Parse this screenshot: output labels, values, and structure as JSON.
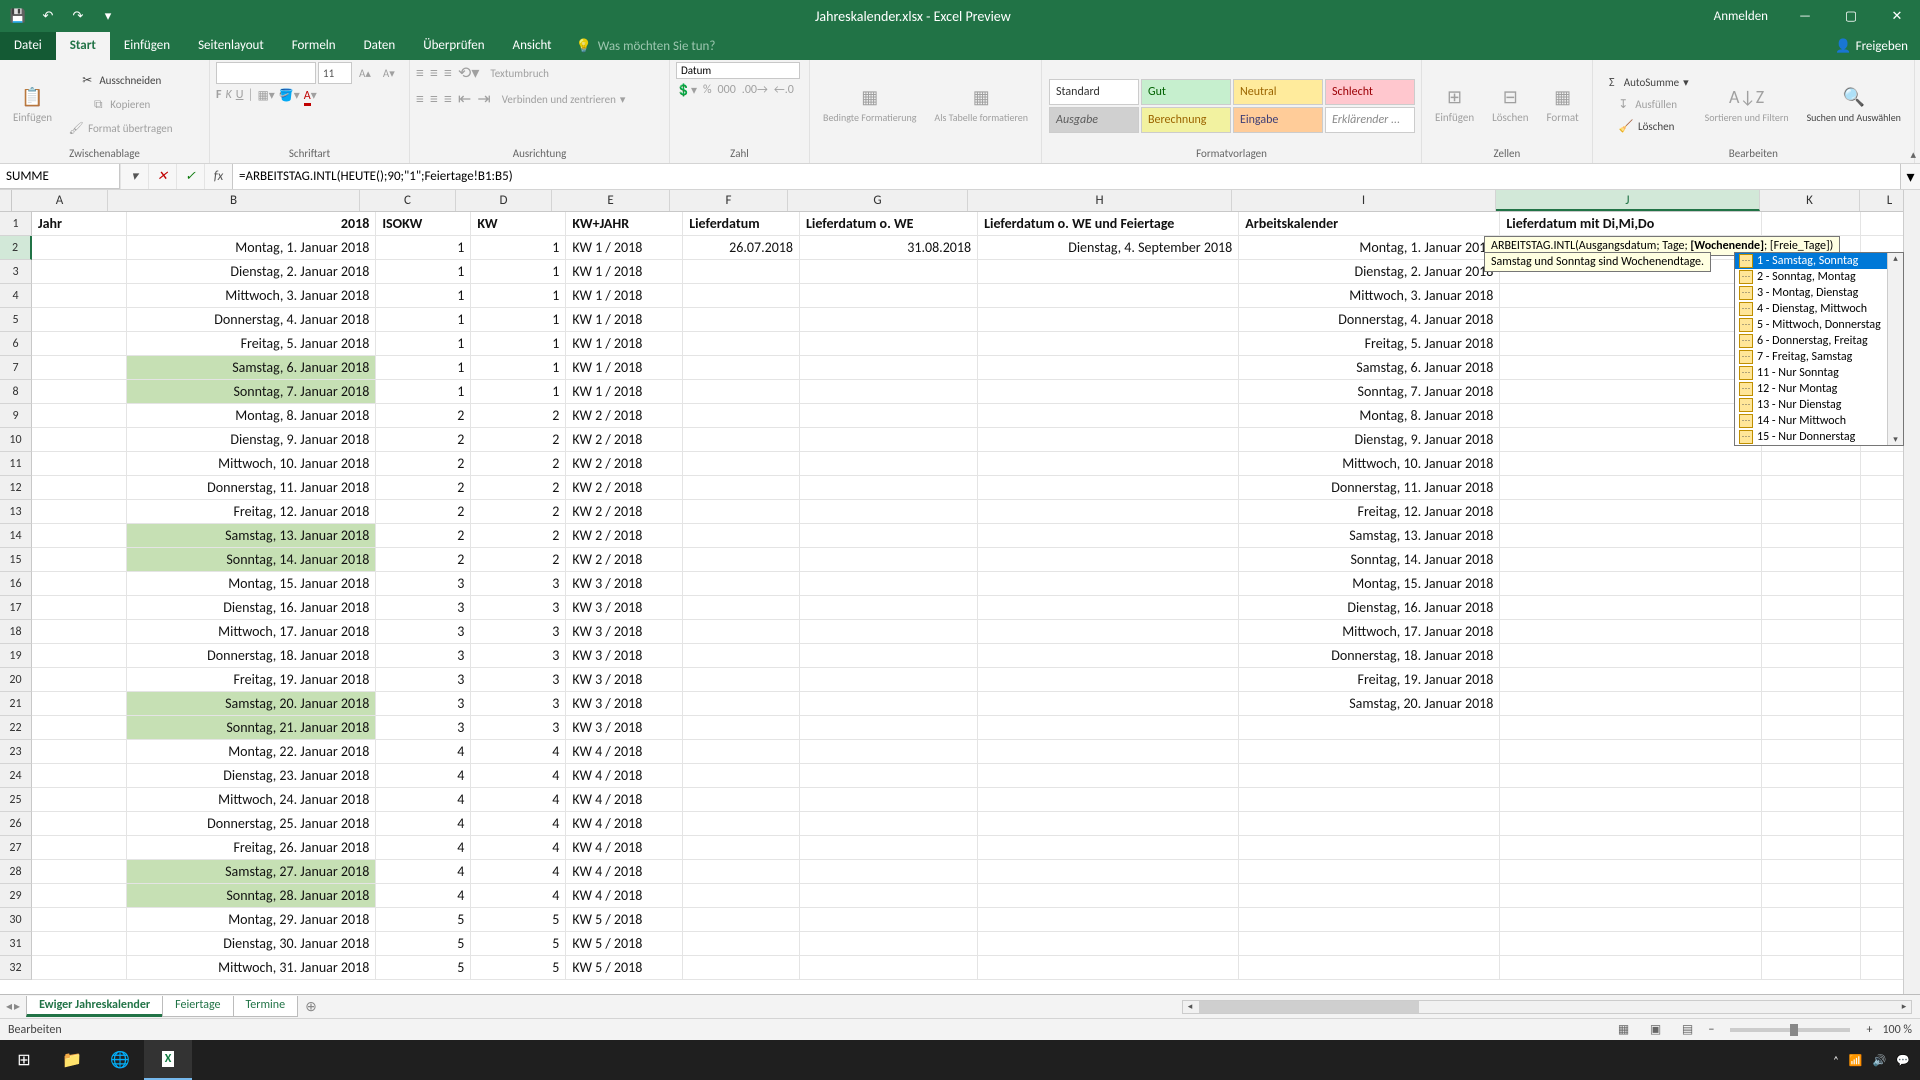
{
  "titlebar": {
    "title": "Jahreskalender.xlsx - Excel Preview",
    "anmelden": "Anmelden"
  },
  "tabs": {
    "file": "Datei",
    "items": [
      "Start",
      "Einfügen",
      "Seitenlayout",
      "Formeln",
      "Daten",
      "Überprüfen",
      "Ansicht"
    ],
    "active": "Start",
    "tellme": "Was möchten Sie tun?",
    "share": "Freigeben"
  },
  "ribbon": {
    "clipboard": {
      "paste": "Einfügen",
      "cut": "Ausschneiden",
      "copy": "Kopieren",
      "painter": "Format übertragen",
      "label": "Zwischenablage"
    },
    "font": {
      "name": "",
      "size": "11",
      "label": "Schriftart"
    },
    "align": {
      "merge": "Verbinden und zentrieren",
      "wrap": "Textumbruch",
      "label": "Ausrichtung"
    },
    "number": {
      "format": "Datum",
      "label": "Zahl"
    },
    "tables": {
      "cond": "Bedingte Formatierung",
      "astable": "Als Tabelle formatieren"
    },
    "styles": {
      "label": "Formatvorlagen",
      "standard": "Standard",
      "gut": "Gut",
      "neutral": "Neutral",
      "schlecht": "Schlecht",
      "ausgabe": "Ausgabe",
      "berechnung": "Berechnung",
      "eingabe": "Eingabe",
      "erklar": "Erklärender ..."
    },
    "cells": {
      "insert": "Einfügen",
      "delete": "Löschen",
      "format": "Format",
      "label": "Zellen"
    },
    "editing": {
      "sum": "AutoSumme",
      "fill": "Ausfüllen",
      "clear": "Löschen",
      "sort": "Sortieren und Filtern",
      "find": "Suchen und Auswählen",
      "label": "Bearbeiten"
    }
  },
  "formulabar": {
    "namebox": "SUMME",
    "formula": "=ARBEITSTAG.INTL(HEUTE();90;\"1\";Feiertage!B1:B5)"
  },
  "tooltip": {
    "sig": "ARBEITSTAG.INTL(Ausgangsdatum; Tage; ",
    "hl": "[Wochenende]",
    "rest": "; [Freie_Tage])",
    "desc": "Samstag und Sonntag sind Wochenendtage."
  },
  "dropdown": {
    "items": [
      {
        "code": "1",
        "label": "Samstag, Sonntag"
      },
      {
        "code": "2",
        "label": "Sonntag, Montag"
      },
      {
        "code": "3",
        "label": "Montag, Dienstag"
      },
      {
        "code": "4",
        "label": "Dienstag, Mittwoch"
      },
      {
        "code": "5",
        "label": "Mittwoch, Donnerstag"
      },
      {
        "code": "6",
        "label": "Donnerstag, Freitag"
      },
      {
        "code": "7",
        "label": "Freitag, Samstag"
      },
      {
        "code": "11",
        "label": "Nur Sonntag"
      },
      {
        "code": "12",
        "label": "Nur Montag"
      },
      {
        "code": "13",
        "label": "Nur Dienstag"
      },
      {
        "code": "14",
        "label": "Nur Mittwoch"
      },
      {
        "code": "15",
        "label": "Nur Donnerstag"
      }
    ],
    "selected": 0
  },
  "columns": [
    "A",
    "B",
    "C",
    "D",
    "E",
    "F",
    "G",
    "H",
    "I",
    "J",
    "K",
    "L"
  ],
  "headers": {
    "A": "Jahr",
    "B": "2018",
    "C": "ISOKW",
    "D": "KW",
    "E": "KW+JAHR",
    "F": "Lieferdatum",
    "G": "Lieferdatum o. WE",
    "H": "Lieferdatum o. WE und Feiertage",
    "I": "Arbeitskalender",
    "J": "Lieferdatum mit Di,Mi,Do"
  },
  "rows": [
    {
      "n": 2,
      "B": "Montag, 1. Januar 2018",
      "C": "1",
      "D": "1",
      "E": "KW 1 / 2018",
      "F": "26.07.2018",
      "G": "31.08.2018",
      "H": "Dienstag, 4. September 2018",
      "I": "Montag, 1. Januar 2018",
      "we": false,
      "J_edit": true
    },
    {
      "n": 3,
      "B": "Dienstag, 2. Januar 2018",
      "C": "1",
      "D": "1",
      "E": "KW 1 / 2018",
      "I": "Dienstag, 2. Januar 2018",
      "we": false
    },
    {
      "n": 4,
      "B": "Mittwoch, 3. Januar 2018",
      "C": "1",
      "D": "1",
      "E": "KW 1 / 2018",
      "I": "Mittwoch, 3. Januar 2018",
      "we": false
    },
    {
      "n": 5,
      "B": "Donnerstag, 4. Januar 2018",
      "C": "1",
      "D": "1",
      "E": "KW 1 / 2018",
      "I": "Donnerstag, 4. Januar 2018",
      "we": false
    },
    {
      "n": 6,
      "B": "Freitag, 5. Januar 2018",
      "C": "1",
      "D": "1",
      "E": "KW 1 / 2018",
      "I": "Freitag, 5. Januar 2018",
      "we": false
    },
    {
      "n": 7,
      "B": "Samstag, 6. Januar 2018",
      "C": "1",
      "D": "1",
      "E": "KW 1 / 2018",
      "I": "Samstag, 6. Januar 2018",
      "we": true
    },
    {
      "n": 8,
      "B": "Sonntag, 7. Januar 2018",
      "C": "1",
      "D": "1",
      "E": "KW 1 / 2018",
      "I": "Sonntag, 7. Januar 2018",
      "we": true
    },
    {
      "n": 9,
      "B": "Montag, 8. Januar 2018",
      "C": "2",
      "D": "2",
      "E": "KW 2 / 2018",
      "I": "Montag, 8. Januar 2018",
      "we": false
    },
    {
      "n": 10,
      "B": "Dienstag, 9. Januar 2018",
      "C": "2",
      "D": "2",
      "E": "KW 2 / 2018",
      "I": "Dienstag, 9. Januar 2018",
      "we": false
    },
    {
      "n": 11,
      "B": "Mittwoch, 10. Januar 2018",
      "C": "2",
      "D": "2",
      "E": "KW 2 / 2018",
      "I": "Mittwoch, 10. Januar 2018",
      "we": false
    },
    {
      "n": 12,
      "B": "Donnerstag, 11. Januar 2018",
      "C": "2",
      "D": "2",
      "E": "KW 2 / 2018",
      "I": "Donnerstag, 11. Januar 2018",
      "we": false
    },
    {
      "n": 13,
      "B": "Freitag, 12. Januar 2018",
      "C": "2",
      "D": "2",
      "E": "KW 2 / 2018",
      "I": "Freitag, 12. Januar 2018",
      "we": false
    },
    {
      "n": 14,
      "B": "Samstag, 13. Januar 2018",
      "C": "2",
      "D": "2",
      "E": "KW 2 / 2018",
      "I": "Samstag, 13. Januar 2018",
      "we": true
    },
    {
      "n": 15,
      "B": "Sonntag, 14. Januar 2018",
      "C": "2",
      "D": "2",
      "E": "KW 2 / 2018",
      "I": "Sonntag, 14. Januar 2018",
      "we": true
    },
    {
      "n": 16,
      "B": "Montag, 15. Januar 2018",
      "C": "3",
      "D": "3",
      "E": "KW 3 / 2018",
      "I": "Montag, 15. Januar 2018",
      "we": false
    },
    {
      "n": 17,
      "B": "Dienstag, 16. Januar 2018",
      "C": "3",
      "D": "3",
      "E": "KW 3 / 2018",
      "I": "Dienstag, 16. Januar 2018",
      "we": false
    },
    {
      "n": 18,
      "B": "Mittwoch, 17. Januar 2018",
      "C": "3",
      "D": "3",
      "E": "KW 3 / 2018",
      "I": "Mittwoch, 17. Januar 2018",
      "we": false
    },
    {
      "n": 19,
      "B": "Donnerstag, 18. Januar 2018",
      "C": "3",
      "D": "3",
      "E": "KW 3 / 2018",
      "I": "Donnerstag, 18. Januar 2018",
      "we": false
    },
    {
      "n": 20,
      "B": "Freitag, 19. Januar 2018",
      "C": "3",
      "D": "3",
      "E": "KW 3 / 2018",
      "I": "Freitag, 19. Januar 2018",
      "we": false
    },
    {
      "n": 21,
      "B": "Samstag, 20. Januar 2018",
      "C": "3",
      "D": "3",
      "E": "KW 3 / 2018",
      "I": "Samstag, 20. Januar 2018",
      "we": true
    },
    {
      "n": 22,
      "B": "Sonntag, 21. Januar 2018",
      "C": "3",
      "D": "3",
      "E": "KW 3 / 2018",
      "we": true
    },
    {
      "n": 23,
      "B": "Montag, 22. Januar 2018",
      "C": "4",
      "D": "4",
      "E": "KW 4 / 2018",
      "we": false
    },
    {
      "n": 24,
      "B": "Dienstag, 23. Januar 2018",
      "C": "4",
      "D": "4",
      "E": "KW 4 / 2018",
      "we": false
    },
    {
      "n": 25,
      "B": "Mittwoch, 24. Januar 2018",
      "C": "4",
      "D": "4",
      "E": "KW 4 / 2018",
      "we": false
    },
    {
      "n": 26,
      "B": "Donnerstag, 25. Januar 2018",
      "C": "4",
      "D": "4",
      "E": "KW 4 / 2018",
      "we": false
    },
    {
      "n": 27,
      "B": "Freitag, 26. Januar 2018",
      "C": "4",
      "D": "4",
      "E": "KW 4 / 2018",
      "we": false
    },
    {
      "n": 28,
      "B": "Samstag, 27. Januar 2018",
      "C": "4",
      "D": "4",
      "E": "KW 4 / 2018",
      "we": true
    },
    {
      "n": 29,
      "B": "Sonntag, 28. Januar 2018",
      "C": "4",
      "D": "4",
      "E": "KW 4 / 2018",
      "we": true
    },
    {
      "n": 30,
      "B": "Montag, 29. Januar 2018",
      "C": "5",
      "D": "5",
      "E": "KW 5 / 2018",
      "we": false
    },
    {
      "n": 31,
      "B": "Dienstag, 30. Januar 2018",
      "C": "5",
      "D": "5",
      "E": "KW 5 / 2018",
      "we": false
    },
    {
      "n": 32,
      "B": "Mittwoch, 31. Januar 2018",
      "C": "5",
      "D": "5",
      "E": "KW 5 / 2018",
      "we": false
    }
  ],
  "editcell": "=ARBEITSTAG.INTL(HEUTE();90;\"1\";Feiertage!B1:B5)",
  "sheets": {
    "active": "Ewiger Jahreskalender",
    "items": [
      "Ewiger Jahreskalender",
      "Feiertage",
      "Termine"
    ]
  },
  "status": {
    "mode": "Bearbeiten",
    "zoom": "100 %"
  }
}
